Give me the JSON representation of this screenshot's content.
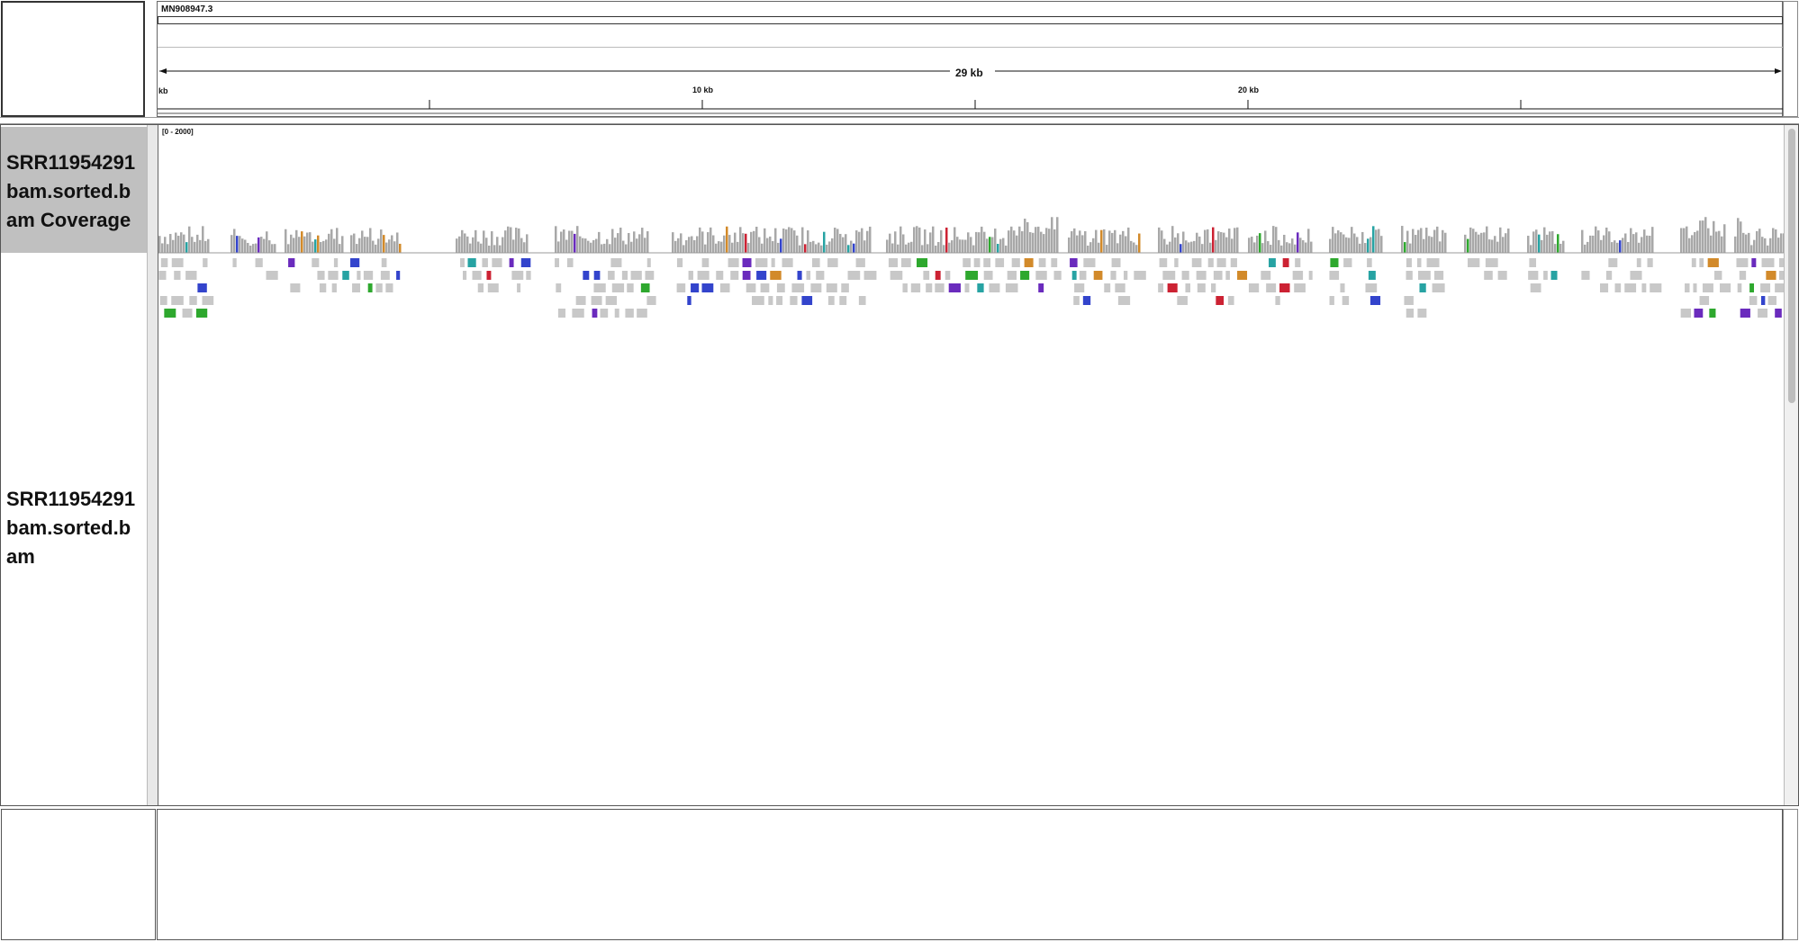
{
  "header": {
    "chromosome": "MN908947.3",
    "span_label": "29 kb",
    "ruler_ticks": [
      "kb",
      "10 kb",
      "20 kb"
    ]
  },
  "tracks": {
    "coverage": {
      "name": "SRR11954291 bam.sorted.b am Coverage",
      "range_label": "[0 - 2000]",
      "bar_color": "#a8a8a8"
    },
    "alignments": {
      "name": "SRR11954291 bam.sorted.b am"
    }
  },
  "colors": {
    "read_gray": "#c8c8c8",
    "mismatch_A": "#2ea82e",
    "mismatch_C": "#3344cc",
    "mismatch_G": "#d28a2a",
    "mismatch_T": "#cc2233",
    "insertion": "#6a2bbd",
    "soft_teal": "#27a3a3"
  }
}
